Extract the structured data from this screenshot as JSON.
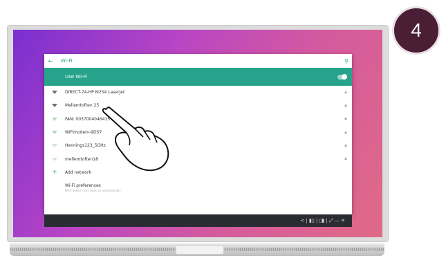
{
  "step_badge": "4",
  "wifi": {
    "title": "Wi-Fi",
    "back_icon": "arrow-back-icon",
    "search_icon": "search-icon",
    "use_wifi_label": "Use Wi-Fi",
    "use_wifi_enabled": true,
    "networks": [
      {
        "name": "DIRECT-74-HP M254 LaserJet",
        "locked": true
      },
      {
        "name": "Mellemtoften 25",
        "locked": true
      },
      {
        "name": "FAN: 0037004046415719",
        "locked": true
      },
      {
        "name": "WiFimodem-9D57",
        "locked": true
      },
      {
        "name": "Hennings123_5GHz",
        "locked": true
      },
      {
        "name": "mellemtoften18",
        "locked": true
      }
    ],
    "add_network_label": "Add network",
    "preferences_title": "Wi-Fi preferences",
    "preferences_subtitle": "Wi-Fi doesn't turn back on automatically"
  },
  "taskbar": {
    "icons": [
      "back-icon",
      "split-left-icon",
      "split-right-icon",
      "expand-icon",
      "minimize-icon",
      "close-icon"
    ],
    "glyphs": "<  |  ▮▯  |  ▯▮  |  ⤢  —  ✕"
  },
  "colors": {
    "accent": "#27a38c",
    "panel_bg": "#ffffff",
    "taskbar_bg": "#2b2b33",
    "badge_bg": "#4a1e35"
  }
}
